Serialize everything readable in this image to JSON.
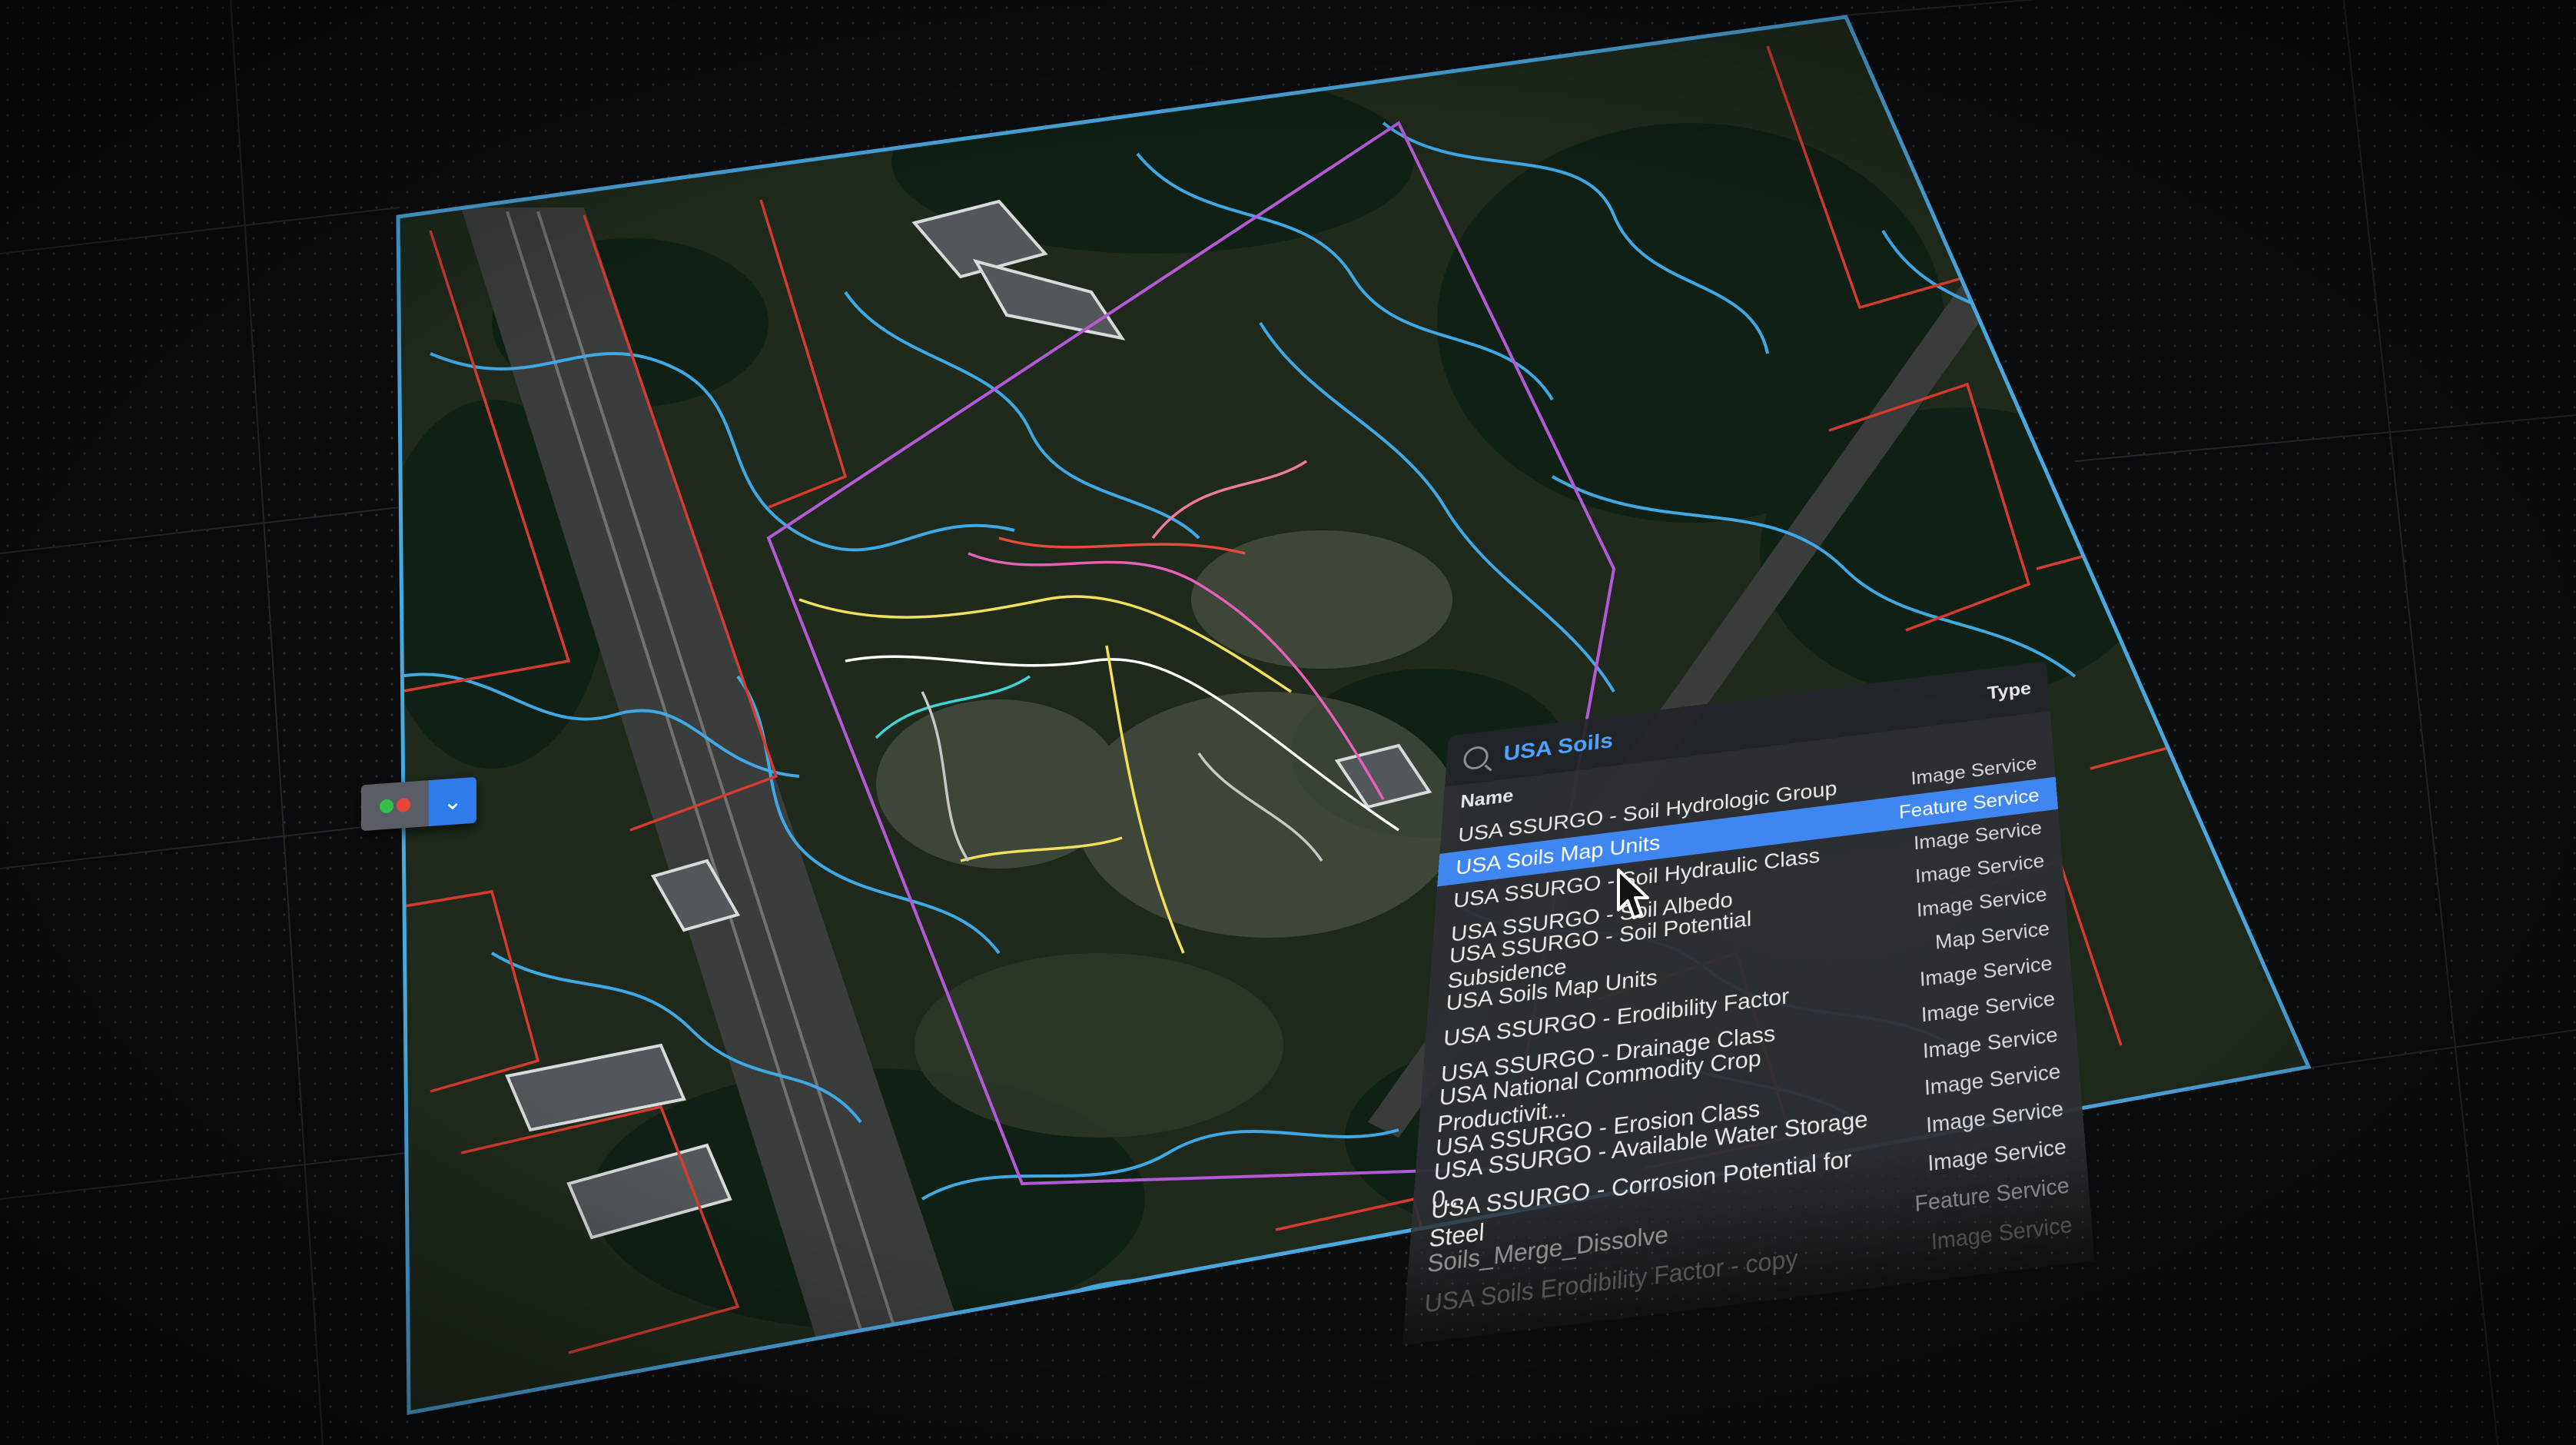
{
  "search": {
    "value": "USA Soils"
  },
  "style_picker": {
    "dot_colors": [
      "#2fbf4a",
      "#e8443a"
    ],
    "chevron": "chevron-down-icon"
  },
  "table": {
    "col_name": "Name",
    "col_type": "Type",
    "rows": [
      {
        "name": "USA SSURGO - Soil Hydrologic Group",
        "type": "Image Service"
      },
      {
        "name": "USA Soils Map Units",
        "type": "Feature Service",
        "selected": true
      },
      {
        "name": "USA SSURGO - Soil Hydraulic Class",
        "type": "Image Service"
      },
      {
        "name": "USA SSURGO - Soil Albedo",
        "type": "Image Service"
      },
      {
        "name": "USA SSURGO - Soil Potential Subsidence",
        "type": "Image Service"
      },
      {
        "name": "USA Soils Map Units",
        "type": "Map Service"
      },
      {
        "name": "USA SSURGO - Erodibility Factor",
        "type": "Image Service"
      },
      {
        "name": "USA SSURGO - Drainage Class",
        "type": "Image Service"
      },
      {
        "name": "USA National Commodity Crop Productivit...",
        "type": "Image Service"
      },
      {
        "name": "USA SSURGO - Erosion Class",
        "type": "Image Service"
      },
      {
        "name": "USA SSURGO - Available Water Storage 0...",
        "type": "Image Service"
      },
      {
        "name": "USA SSURGO - Corrosion Potential for Steel",
        "type": "Image Service"
      },
      {
        "name": "Soils_Merge_Dissolve",
        "type": "Feature Service"
      },
      {
        "name": "USA Soils Erodibility Factor - copy",
        "type": "Image Service"
      }
    ]
  },
  "colors": {
    "background": "#0b0c0e",
    "map_border": "#4aa8e0",
    "soil_lines": "#3fa9e6",
    "parcel_lines": "#d63b2e",
    "site_boundary": "#b45ad6",
    "selection": "#3f86f0"
  }
}
